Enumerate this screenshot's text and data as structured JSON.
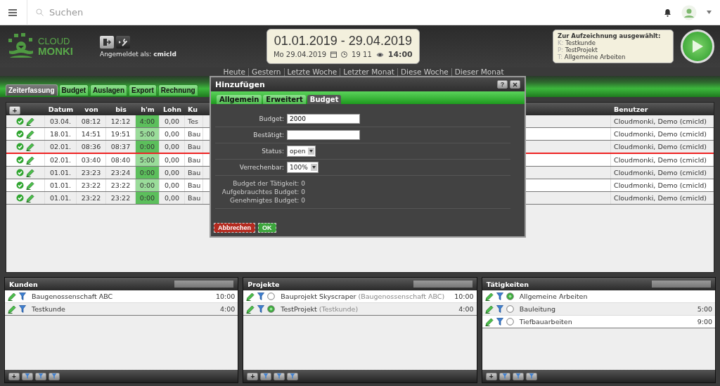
{
  "topbar": {
    "search": {
      "placeholder": "Suchen"
    }
  },
  "header": {
    "logo": [
      "CLOUD",
      "MONKI"
    ],
    "login_label": "Angemeldet als:",
    "login_user": "cmicld",
    "date_range": "01.01.2019 - 29.04.2019",
    "date": "Mo 29.04.2019",
    "clock_time": "19 11",
    "view_time": "14:00",
    "selection": {
      "title": "Zur Aufzeichnung ausgewählt:",
      "items": [
        {
          "prefix": "K:",
          "value": "Testkunde"
        },
        {
          "prefix": "P:",
          "value": "TestProjekt"
        },
        {
          "prefix": "T:",
          "value": "Allgemeine Arbeiten"
        }
      ]
    }
  },
  "quick_links": [
    "Heute",
    "Gestern",
    "Letzte Woche",
    "Letzter Monat",
    "Diese Woche",
    "Dieser Monat"
  ],
  "tabs": [
    {
      "label": "Zeiterfassung",
      "selected": true
    },
    {
      "label": "Budget",
      "selected": false
    },
    {
      "label": "Auslagen",
      "selected": false
    },
    {
      "label": "Export",
      "selected": false
    },
    {
      "label": "Rechnung",
      "selected": false
    }
  ],
  "table": {
    "add_button": "+",
    "columns": [
      "Datum",
      "von",
      "bis",
      "h'm",
      "Lohn",
      "Ku",
      "Benutzer"
    ],
    "rows": [
      {
        "datum": "03.04.",
        "von": "08:12",
        "bis": "12:12",
        "hm": "4:00",
        "lohn": "0,00",
        "ku": "Tes",
        "benutzer": "Cloudmonki, Demo (cmicld)",
        "marker_after": false
      },
      {
        "datum": "18.01.",
        "von": "14:51",
        "bis": "19:51",
        "hm": "5:00",
        "lohn": "0,00",
        "ku": "Bau",
        "benutzer": "Cloudmonki, Demo (cmicld)",
        "marker_after": false
      },
      {
        "datum": "02.01.",
        "von": "08:36",
        "bis": "08:37",
        "hm": "0:00",
        "lohn": "0,00",
        "ku": "Bau",
        "benutzer": "Cloudmonki, Demo (cmicld)",
        "marker_after": true
      },
      {
        "datum": "02.01.",
        "von": "03:40",
        "bis": "08:40",
        "hm": "5:00",
        "lohn": "0,00",
        "ku": "Bau",
        "benutzer": "Cloudmonki, Demo (cmicld)",
        "marker_after": false
      },
      {
        "datum": "01.01.",
        "von": "23:23",
        "bis": "23:24",
        "hm": "0:00",
        "lohn": "0,00",
        "ku": "Bau",
        "benutzer": "Cloudmonki, Demo (cmicld)",
        "marker_after": false
      },
      {
        "datum": "01.01.",
        "von": "23:22",
        "bis": "23:22",
        "hm": "0:00",
        "lohn": "0,00",
        "ku": "Bau",
        "benutzer": "Cloudmonki, Demo (cmicld)",
        "marker_after": false
      },
      {
        "datum": "01.01.",
        "von": "23:22",
        "bis": "23:22",
        "hm": "0:00",
        "lohn": "0,00",
        "ku": "Bau",
        "benutzer": "Cloudmonki, Demo (cmicld)",
        "marker_after": false
      }
    ]
  },
  "dialog": {
    "title": "Hinzufügen",
    "help_button": "?",
    "tabs": [
      {
        "label": "Allgemein",
        "selected": false
      },
      {
        "label": "Erweitert",
        "selected": false
      },
      {
        "label": "Budget",
        "selected": true
      }
    ],
    "fields": [
      {
        "kind": "input",
        "label": "Budget:",
        "value": "2000"
      },
      {
        "kind": "input",
        "label": "Bestätigt:"
      },
      {
        "kind": "select",
        "label": "Status:",
        "value": "open"
      },
      {
        "kind": "select",
        "label": "Verrechenbar:",
        "value": "100%"
      }
    ],
    "info": [
      {
        "label": "Budget der Tätigkeit:",
        "value": "0"
      },
      {
        "label": "Aufgebrauchtes Budget:",
        "value": "0"
      },
      {
        "label": "Genehmigtes Budget:",
        "value": "0"
      }
    ],
    "buttons": [
      {
        "kind": "cancel",
        "label": "Abbrechen"
      },
      {
        "kind": "ok",
        "label": "OK"
      }
    ]
  },
  "panels": [
    {
      "title": "Kunden",
      "add_button": "+",
      "items": [
        {
          "name": "Baugenossenschaft ABC",
          "hours": "10:00"
        },
        {
          "name": "Testkunde",
          "hours": "4:00"
        }
      ]
    },
    {
      "title": "Projekte",
      "add_button": "+",
      "items": [
        {
          "name": "Bauprojekt Skyscraper",
          "detail": "(Baugenossenschaft ABC)",
          "hours": "10:00",
          "selected": false
        },
        {
          "name": "TestProjekt",
          "detail": "(Testkunde)",
          "hours": "4:00",
          "selected": true
        }
      ]
    },
    {
      "title": "Tätigkeiten",
      "add_button": "+",
      "items": [
        {
          "name": "Allgemeine Arbeiten",
          "selected": true
        },
        {
          "name": "Bauleitung",
          "hours": "5:00",
          "selected": false
        },
        {
          "name": "Tiefbauarbeiten",
          "hours": "9:00",
          "selected": false
        }
      ]
    }
  ]
}
